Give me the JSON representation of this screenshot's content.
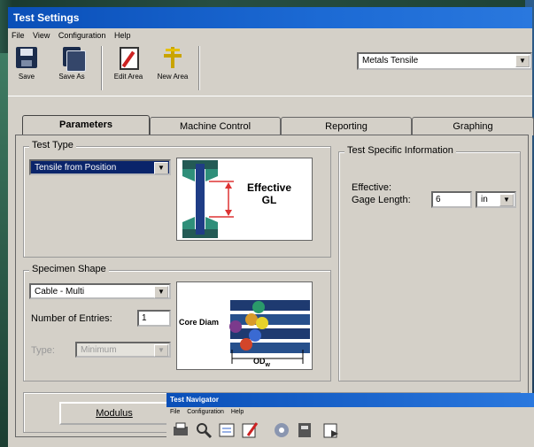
{
  "window": {
    "title": "Test Settings"
  },
  "menu": [
    "File",
    "View",
    "Configuration",
    "Help"
  ],
  "toolbar": {
    "save_label": "Save",
    "save_as_label": "Save As",
    "edit_area_label": "Edit Area",
    "new_area_label": "New Area",
    "method_value": "Metals Tensile"
  },
  "tabs": [
    "Parameters",
    "Machine Control",
    "Reporting",
    "Graphing"
  ],
  "test_type": {
    "legend": "Test Type",
    "value": "Tensile from Position",
    "diagram_label_1": "Effective",
    "diagram_label_2": "GL"
  },
  "specimen": {
    "legend": "Specimen Shape",
    "shape_value": "Cable - Multi",
    "entries_label": "Number of Entries:",
    "entries_value": "1",
    "type_label": "Type:",
    "type_value": "Minimum",
    "diagram_label": "Core Diam",
    "diagram_od": "OD",
    "diagram_od_sub": "w"
  },
  "test_info": {
    "legend": "Test Specific Information",
    "effective_label": "Effective:",
    "gage_label": "Gage Length:",
    "gage_value": "6",
    "unit_value": "in"
  },
  "bottom": {
    "modulus_label": "Modulus"
  },
  "navigator": {
    "title": "Test Navigator",
    "menu": [
      "File",
      "Configuration",
      "Help"
    ]
  },
  "colors": {
    "title_blue": "#0a4fb8",
    "selection": "#0a246a",
    "face": "#d4d0c8"
  }
}
